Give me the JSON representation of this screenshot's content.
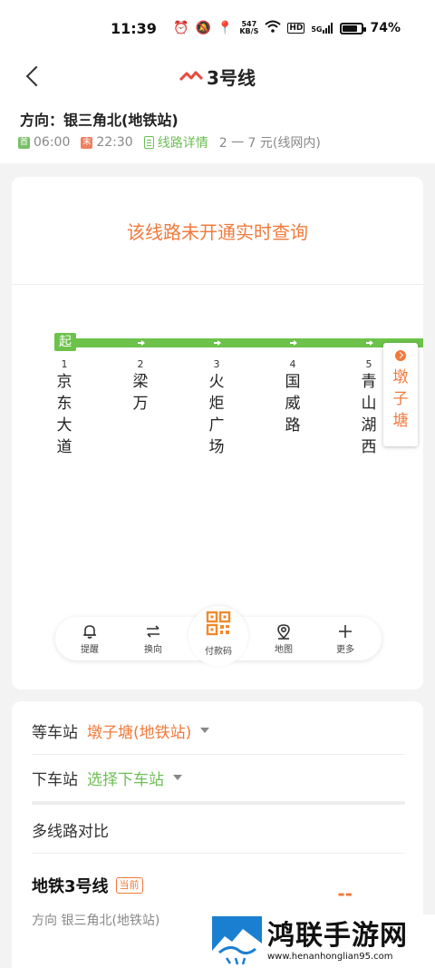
{
  "status_bar": {
    "time": "11:39",
    "net_speed_top": "547",
    "net_speed_bottom": "KB/S",
    "hd": "HD",
    "signal": "5G",
    "battery": "74%"
  },
  "header": {
    "title": "3号线",
    "direction": "方向：银三角北(地铁站)",
    "first_bus_tag": "首",
    "first_bus_time": "06:00",
    "last_bus_tag": "末",
    "last_bus_time": "22:30",
    "detail_link": "线路详情",
    "fare": "2 一 7 元(线网内)"
  },
  "route": {
    "realtime_message": "该线路未开通实时查询",
    "start_label": "起",
    "stations": [
      {
        "num": "1",
        "name": "京东大道"
      },
      {
        "num": "2",
        "name": "梁万"
      },
      {
        "num": "3",
        "name": "火炬广场"
      },
      {
        "num": "4",
        "name": "国威路"
      },
      {
        "num": "5",
        "name": "青山湖西"
      }
    ],
    "current_station": "墩子塘",
    "line_color": "#6cc24a",
    "accent_color": "#f07a3c"
  },
  "toolbar": {
    "remind": "提醒",
    "reverse": "换向",
    "pay": "付款码",
    "map": "地图",
    "more": "更多"
  },
  "bottom": {
    "wait_label": "等车站",
    "wait_value": "墩子塘(地铁站)",
    "alight_label": "下车站",
    "alight_value": "选择下车站",
    "compare": "多线路对比",
    "metro_title": "地铁3号线",
    "current_tag": "当前",
    "metro_direction": "方向 银三角北(地铁站)",
    "eta": "--"
  },
  "watermark": {
    "title": "鸿联手游网",
    "url": "www.henanhonglian95.com"
  }
}
